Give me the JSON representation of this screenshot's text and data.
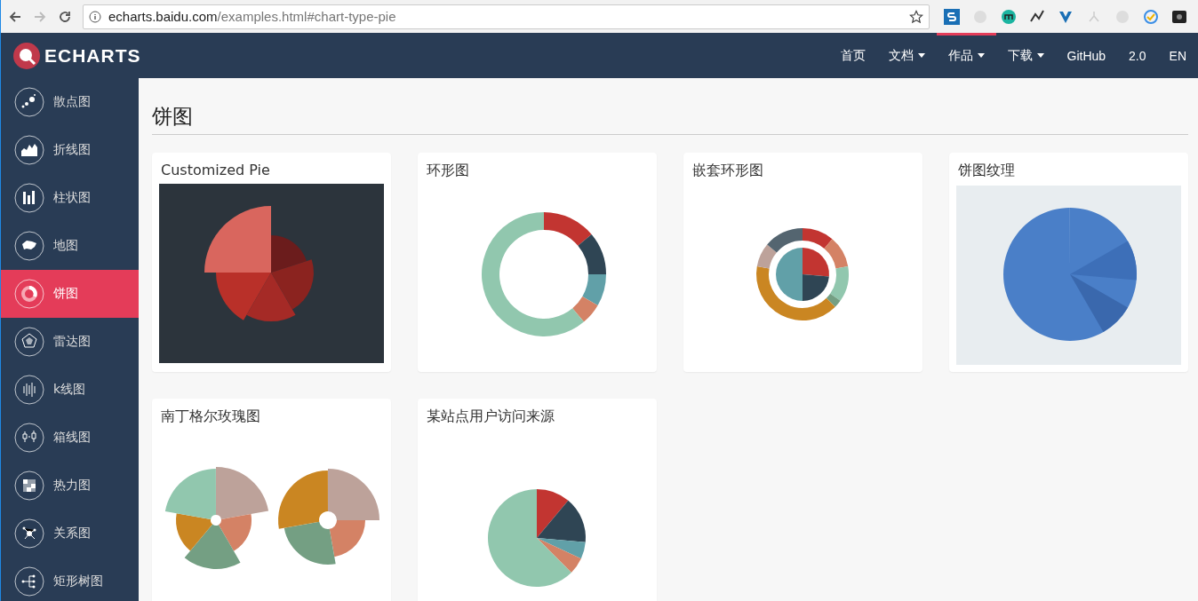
{
  "browser": {
    "address": {
      "host": "echarts.baidu.com",
      "path": "/examples.html#chart-type-pie"
    }
  },
  "navbar": {
    "logo": "ECHARTS",
    "items": [
      {
        "label": "首页",
        "dropdown": false,
        "selected": false
      },
      {
        "label": "文档",
        "dropdown": true,
        "selected": false
      },
      {
        "label": "作品",
        "dropdown": true,
        "selected": true
      },
      {
        "label": "下载",
        "dropdown": true,
        "selected": false
      },
      {
        "label": "GitHub",
        "dropdown": false,
        "selected": false
      },
      {
        "label": "2.0",
        "dropdown": false,
        "selected": false
      },
      {
        "label": "EN",
        "dropdown": false,
        "selected": false
      }
    ]
  },
  "sidebar": {
    "items": [
      {
        "label": "散点图",
        "selected": false
      },
      {
        "label": "折线图",
        "selected": false
      },
      {
        "label": "柱状图",
        "selected": false
      },
      {
        "label": "地图",
        "selected": false
      },
      {
        "label": "饼图",
        "selected": true
      },
      {
        "label": "雷达图",
        "selected": false
      },
      {
        "label": "k线图",
        "selected": false
      },
      {
        "label": "箱线图",
        "selected": false
      },
      {
        "label": "热力图",
        "selected": false
      },
      {
        "label": "关系图",
        "selected": false
      },
      {
        "label": "矩形树图",
        "selected": false
      }
    ]
  },
  "page": {
    "title": "饼图",
    "cards": [
      {
        "title": "Customized Pie"
      },
      {
        "title": "环形图"
      },
      {
        "title": "嵌套环形图"
      },
      {
        "title": "饼图纹理"
      },
      {
        "title": "南丁格尔玫瑰图"
      },
      {
        "title": "某站点用户访问来源"
      }
    ]
  }
}
